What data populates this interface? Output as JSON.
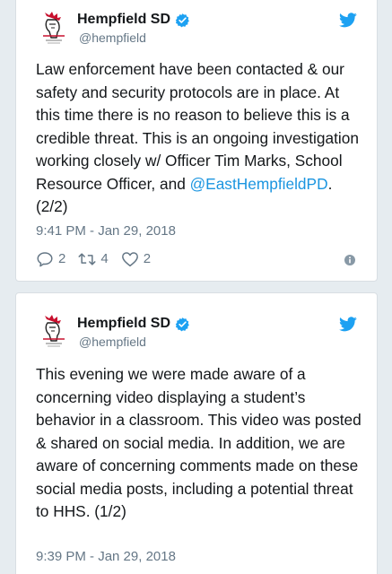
{
  "tweets": [
    {
      "display_name": "Hempfield SD",
      "handle": "@hempfield",
      "text_before": "Law enforcement have been contacted & our safety and security protocols are in place. At this time there is no reason to believe this is a credible threat. This is an ongoing investigation working closely w/ Officer Tim Marks, School Resource Officer, and ",
      "mention": "@EastHempfieldPD",
      "text_after": ". (2/2)",
      "timestamp": "9:41 PM - Jan 29, 2018",
      "replies": "2",
      "retweets": "4",
      "likes": "2"
    },
    {
      "display_name": "Hempfield SD",
      "handle": "@hempfield",
      "text_before": "This evening we were made aware of a concerning video displaying a student’s behavior in a classroom. This video was posted & shared on social media. In addition, we are aware of concerning comments made on these social media posts, including a potential threat to HHS. (1/2)",
      "mention": "",
      "text_after": "",
      "timestamp": "9:39 PM - Jan 29, 2018"
    }
  ],
  "icons": {
    "avatar": "hempfield-logo",
    "verified": "verified-badge-icon",
    "brand": "twitter-bird-icon",
    "reply": "reply-icon",
    "retweet": "retweet-icon",
    "like": "heart-icon",
    "info": "info-icon"
  },
  "colors": {
    "background": "#e6ecf0",
    "link": "#1b95e0",
    "twitter_blue": "#1da1f2",
    "text": "#14171a",
    "muted": "#657786"
  }
}
